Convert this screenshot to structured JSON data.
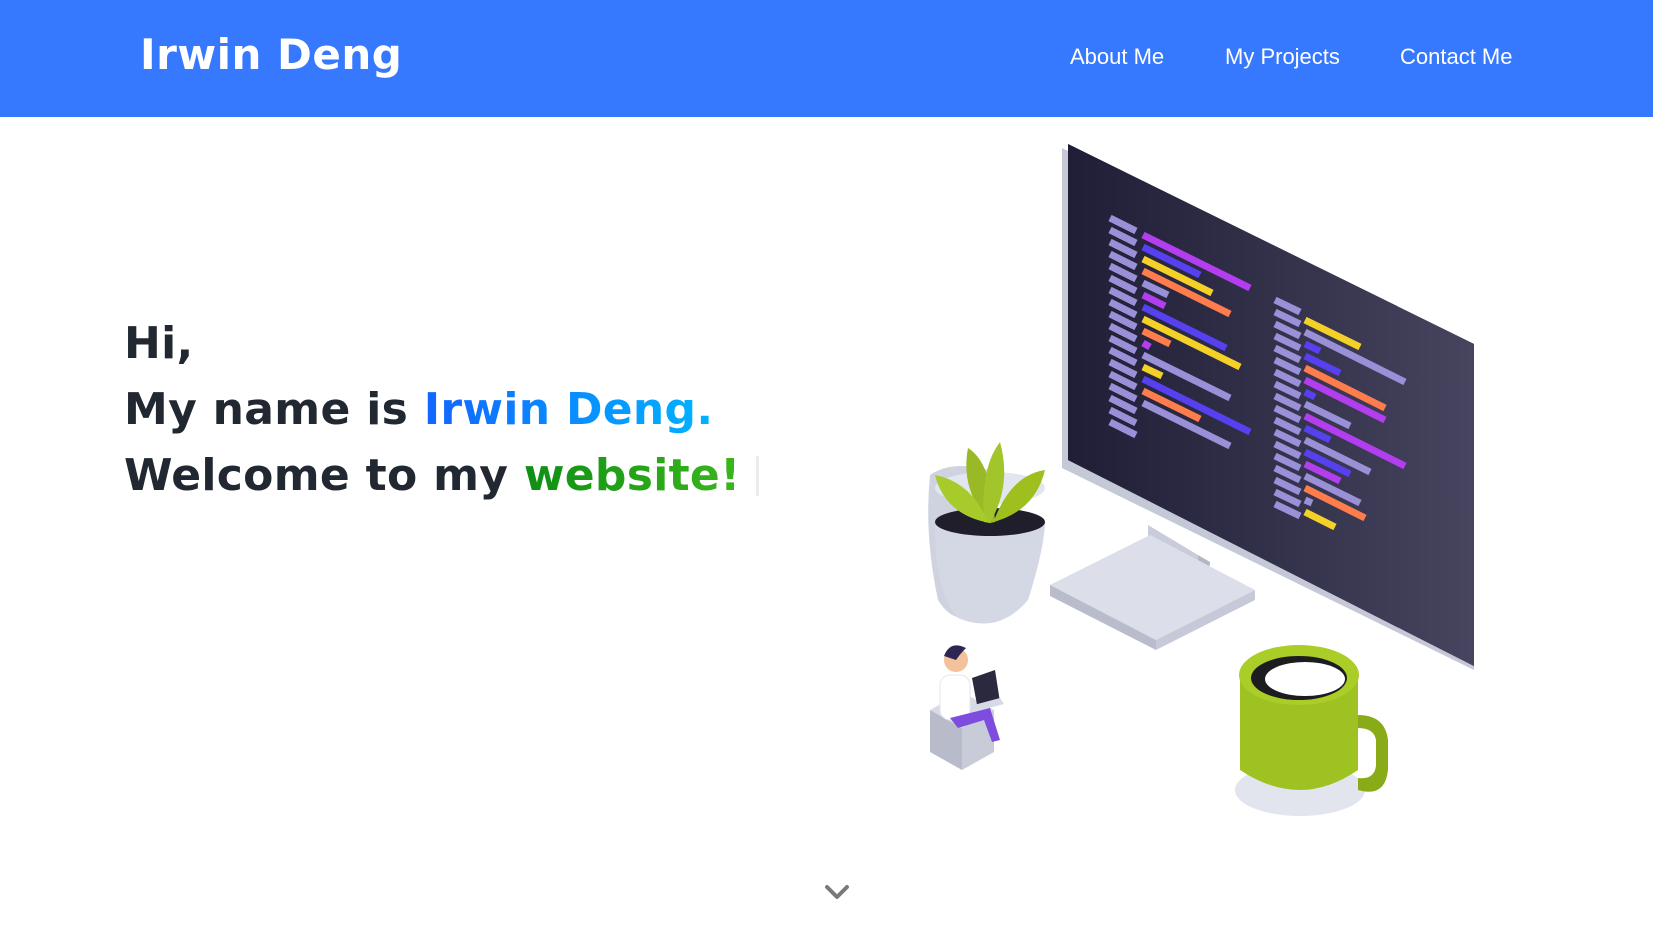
{
  "navbar": {
    "brand": "Irwin Deng",
    "links": [
      "About Me",
      "My Projects",
      "Contact Me"
    ]
  },
  "hero": {
    "line1": "Hi,",
    "line2_prefix": "My name is ",
    "line2_name": "Irwin Deng.",
    "line3_prefix": "Welcome to my ",
    "line3_highlight": "website!"
  },
  "colors": {
    "navbar_bg": "#3679ff",
    "text_dark": "#222831",
    "name_gradient": [
      "#1265ff",
      "#00b4ff"
    ],
    "website_gradient": [
      "#0e8f14",
      "#3bb71c"
    ]
  },
  "icons": {
    "scroll_down": "chevron-down-icon"
  }
}
